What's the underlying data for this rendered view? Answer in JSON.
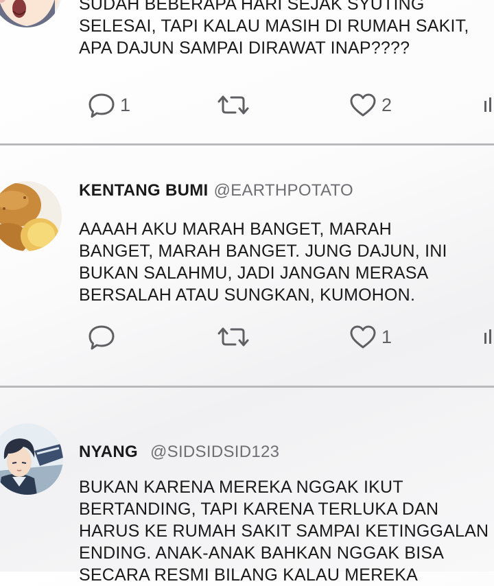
{
  "tweets": [
    {
      "body": [
        "SUDAH BEBERAPA HARI SEJAK SYUTING",
        "SELESAI, TAPI KALAU MASIH DI RUMAH SAKIT,",
        "APA DAJUN SAMPAI DIRAWAT INAP????"
      ],
      "reply_count": "1",
      "like_count": "2",
      "avatar_icon": "cartoon-face-avatar"
    },
    {
      "display_name": "KENTANG BUMI",
      "handle": "@EARTHPOTATO",
      "body": [
        "AAAAH AKU MARAH BANGET, MARAH",
        "BANGET, MARAH BANGET. JUNG DAJUN, INI",
        "BUKAN SALAHMU, JADI JANGAN MERASA",
        "BERSALAH ATAU SUNGKAN, KUMOHON."
      ],
      "reply_count": "",
      "like_count": "1",
      "avatar_icon": "potato-avatar"
    },
    {
      "display_name": "NYANG",
      "handle": "@SIDSIDSID123",
      "body": [
        "BUKAN KARENA MEREKA NGGAK IKUT",
        "BERTANDING, TAPI KARENA TERLUKA DAN",
        "HARUS KE RUMAH SAKIT SAMPAI KETINGGALAN",
        "ENDING. ANAK-ANAK BAHKAN NGGAK BISA",
        "SECARA RESMI BILANG KALAU MEREKA"
      ],
      "avatar_icon": "anime-boy-avatar"
    }
  ],
  "colors": {
    "icon_gray": "#5f5f63",
    "divider": "#b9b9bc",
    "text": "#1a1a1a"
  }
}
